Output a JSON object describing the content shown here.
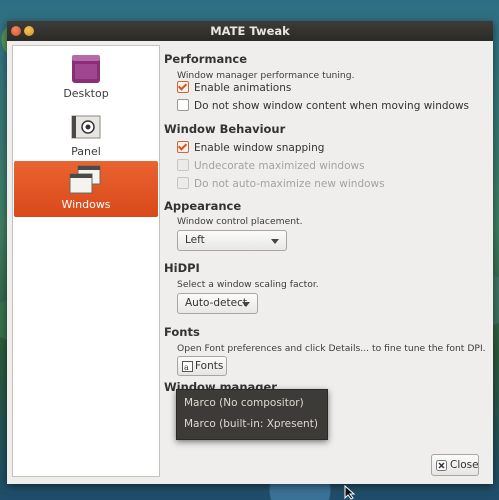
{
  "window": {
    "title": "MATE Tweak"
  },
  "sidebar": {
    "items": [
      {
        "label": "Desktop",
        "icon": "desktop-icon"
      },
      {
        "label": "Panel",
        "icon": "panel-icon"
      },
      {
        "label": "Windows",
        "icon": "windows-icon",
        "active": true
      }
    ]
  },
  "performance": {
    "heading": "Performance",
    "description": "Window manager performance tuning.",
    "enable_animations": {
      "label": "Enable animations",
      "checked": true
    },
    "no_window_content": {
      "label": "Do not show window content when moving windows",
      "checked": false
    }
  },
  "behaviour": {
    "heading": "Window Behaviour",
    "enable_snapping": {
      "label": "Enable window snapping",
      "checked": true
    },
    "undecorate_maximized": {
      "label": "Undecorate maximized windows",
      "checked": false,
      "enabled": false
    },
    "no_auto_maximize": {
      "label": "Do not auto-maximize new windows",
      "checked": false,
      "enabled": false
    }
  },
  "appearance": {
    "heading": "Appearance",
    "description": "Window control placement.",
    "placement_value": "Left"
  },
  "hidpi": {
    "heading": "HiDPI",
    "description": "Select a window scaling factor.",
    "scaling_value": "Auto-detect"
  },
  "fonts": {
    "heading": "Fonts",
    "description": "Open Font preferences and click Details... to fine tune the font DPI.",
    "button_label": "Fonts"
  },
  "window_manager": {
    "heading": "Window manager",
    "options": [
      "Marco (No compositor)",
      "Marco (built-in: Xpresent)"
    ]
  },
  "footer": {
    "close_label": "Close"
  },
  "colors": {
    "accent": "#e05a28",
    "titlebar": "#2f2e2b",
    "popup": "#3c3b37"
  }
}
